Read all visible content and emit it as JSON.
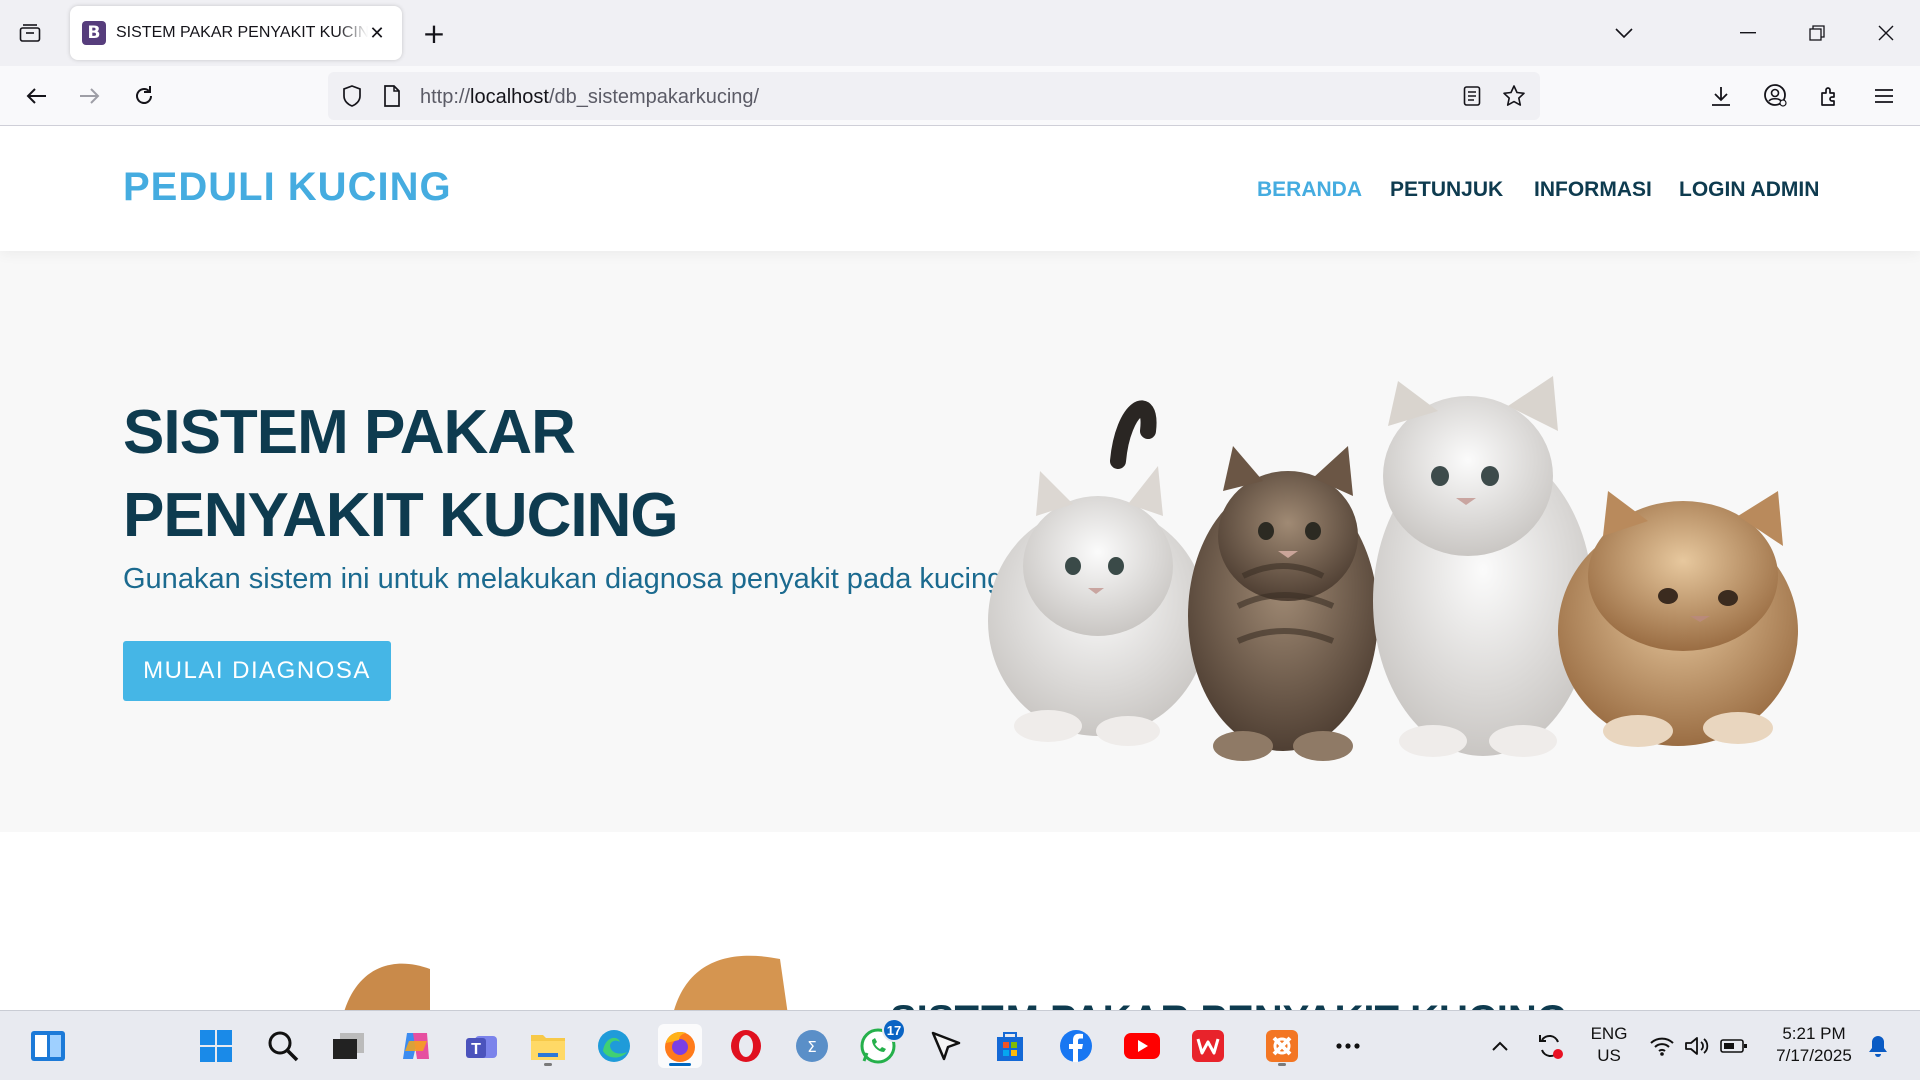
{
  "browser": {
    "tab_title": "SISTEM PAKAR PENYAKIT KUCING",
    "tab_favicon_letter": "B",
    "url_prefix": "http://",
    "url_host": "localhost",
    "url_path": "/db_sistempakarkucing/",
    "icons": [
      "tab-list-icon",
      "close-icon",
      "plus-icon",
      "chevron-down-icon",
      "minimize-icon",
      "restore-icon",
      "window-close-icon",
      "back-arrow-icon",
      "forward-arrow-icon",
      "reload-icon",
      "shield-icon",
      "page-icon",
      "reader-view-icon",
      "star-icon",
      "download-icon",
      "account-icon",
      "extensions-icon",
      "hamburger-menu-icon"
    ]
  },
  "site": {
    "brand": "PEDULI KUCING",
    "nav": [
      {
        "label": "BERANDA",
        "active": true
      },
      {
        "label": "PETUNJUK",
        "active": false
      },
      {
        "label": "INFORMASI",
        "active": false
      },
      {
        "label": "LOGIN ADMIN",
        "active": false
      }
    ],
    "hero": {
      "title": "SISTEM PAKAR PENYAKIT KUCING",
      "subtitle": "Gunakan sistem ini untuk melakukan diagnosa penyakit pada kucing",
      "button": "MULAI DIAGNOSA"
    },
    "section2_title": "SISTEM PAKAR PENYAKIT KUCING",
    "colors": {
      "brand": "#45ace0",
      "dark": "#0e3b4f",
      "button": "#45b6e6",
      "hero_bg": "#f8f8f8"
    }
  },
  "taskbar": {
    "apps": [
      "widgets-icon",
      "windows-start-icon",
      "search-icon",
      "task-view-icon",
      "copilot-icon",
      "teams-icon",
      "file-explorer-icon",
      "edge-icon",
      "firefox-icon",
      "opera-icon",
      "calculator-icon",
      "whatsapp-icon",
      "cursor-app-icon",
      "store-icon",
      "facebook-icon",
      "youtube-icon",
      "wps-icon",
      "xampp-icon",
      "more-icon"
    ],
    "whatsapp_badge": "17",
    "lang_top": "ENG",
    "lang_bottom": "US",
    "time": "5:21 PM",
    "date": "7/17/2025"
  }
}
